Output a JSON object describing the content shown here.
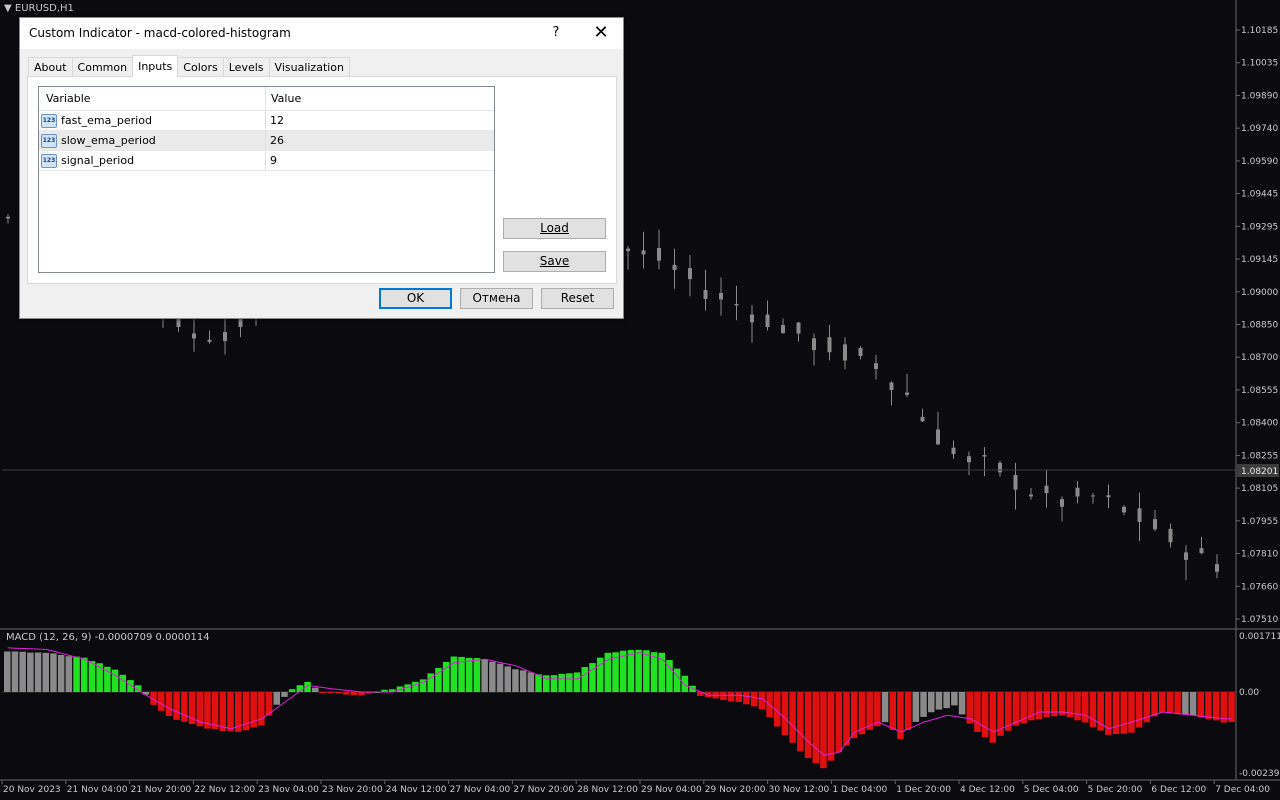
{
  "window": {
    "symbol": "EURUSD,H1",
    "macd_label": "MACD (12, 26, 9)  -0.0000709 0.0000114"
  },
  "dialog": {
    "title": "Custom Indicator - macd-colored-histogram",
    "help_glyph": "?",
    "close_glyph": "✕",
    "tabs": [
      {
        "label": "About"
      },
      {
        "label": "Common"
      },
      {
        "label": "Inputs"
      },
      {
        "label": "Colors"
      },
      {
        "label": "Levels"
      },
      {
        "label": "Visualization"
      }
    ],
    "active_tab": "Inputs",
    "grid": {
      "columns": [
        "Variable",
        "Value"
      ],
      "rows": [
        {
          "icon": "123",
          "variable": "fast_ema_period",
          "value": "12"
        },
        {
          "icon": "123",
          "variable": "slow_ema_period",
          "value": "26"
        },
        {
          "icon": "123",
          "variable": "signal_period",
          "value": "9"
        }
      ]
    },
    "load_label": "Load",
    "save_label": "Save",
    "ok_label": "OK",
    "cancel_label": "Отмена",
    "reset_label": "Reset"
  },
  "colors": {
    "background": "#0b0b0f",
    "candle": "#8a8a8a",
    "histogram_green": "#22e022",
    "histogram_red": "#e01010",
    "histogram_gray": "#8a8a8a",
    "signal_line": "#e020e0",
    "current_price_bg": "#3c3c3c"
  },
  "chart_data": [
    {
      "type": "candlestick",
      "title": "EURUSD,H1",
      "y_ticks": [
        "1.10185",
        "1.10035",
        "1.09890",
        "1.09740",
        "1.09590",
        "1.09445",
        "1.09295",
        "1.09145",
        "1.09000",
        "1.08850",
        "1.08700",
        "1.08555",
        "1.08400",
        "1.08255",
        "1.08105",
        "1.07955",
        "1.07810",
        "1.07660",
        "1.07510"
      ],
      "ylim": [
        1.0751,
        1.1026
      ],
      "current_price": "1.08201",
      "close_path": [
        [
          0,
          1.093
        ],
        [
          5,
          1.0935
        ],
        [
          8,
          1.0905
        ],
        [
          10,
          1.0888
        ],
        [
          12,
          1.0873
        ],
        [
          14,
          1.0876
        ],
        [
          16,
          1.0883
        ],
        [
          18,
          1.0895
        ],
        [
          20,
          1.0925
        ],
        [
          22,
          1.096
        ],
        [
          24,
          1.099
        ],
        [
          26,
          1.1005
        ],
        [
          28,
          1.1
        ],
        [
          30,
          1.0988
        ],
        [
          32,
          1.0975
        ],
        [
          34,
          1.0965
        ],
        [
          36,
          1.0948
        ],
        [
          38,
          1.0925
        ],
        [
          40,
          1.0915
        ],
        [
          42,
          1.091
        ],
        [
          44,
          1.09
        ],
        [
          46,
          1.0892
        ],
        [
          48,
          1.0885
        ],
        [
          50,
          1.0878
        ],
        [
          52,
          1.087
        ],
        [
          54,
          1.0865
        ],
        [
          56,
          1.086
        ],
        [
          58,
          1.0845
        ],
        [
          60,
          1.0825
        ],
        [
          62,
          1.0812
        ],
        [
          64,
          1.0808
        ],
        [
          66,
          1.0798
        ],
        [
          68,
          1.0793
        ],
        [
          70,
          1.0795
        ],
        [
          72,
          1.0789
        ],
        [
          74,
          1.078
        ],
        [
          76,
          1.077
        ],
        [
          78,
          1.0763
        ]
      ]
    },
    {
      "type": "bar",
      "title": "MACD (12, 26, 9)",
      "values_text": [
        "-0.0000709",
        "0.0000114"
      ],
      "y_ticks": [
        "0.0017115",
        "0.00",
        "-0.0023995"
      ],
      "ylim": [
        -0.0023995,
        0.0017115
      ],
      "x_ticks": [
        "20 Nov 2023",
        "21 Nov 04:00",
        "21 Nov 20:00",
        "22 Nov 12:00",
        "23 Nov 04:00",
        "23 Nov 20:00",
        "24 Nov 12:00",
        "27 Nov 04:00",
        "27 Nov 20:00",
        "28 Nov 12:00",
        "29 Nov 04:00",
        "29 Nov 20:00",
        "30 Nov 12:00",
        "1 Dec 04:00",
        "1 Dec 20:00",
        "4 Dec 12:00",
        "5 Dec 04:00",
        "5 Dec 20:00",
        "6 Dec 12:00",
        "7 Dec 04:00"
      ],
      "histogram_path": [
        [
          0,
          0.00125
        ],
        [
          6,
          0.00118
        ],
        [
          10,
          0.00105
        ],
        [
          14,
          0.0007
        ],
        [
          17,
          0.0002
        ],
        [
          19,
          -0.0004
        ],
        [
          22,
          -0.00085
        ],
        [
          26,
          -0.0011
        ],
        [
          30,
          -0.0012
        ],
        [
          33,
          -0.001
        ],
        [
          35,
          -0.0004
        ],
        [
          37,
          0.0001
        ],
        [
          39,
          0.0003
        ],
        [
          41,
          0.0
        ],
        [
          46,
          -0.0001
        ],
        [
          50,
          0.0001
        ],
        [
          54,
          0.0004
        ],
        [
          58,
          0.0011
        ],
        [
          62,
          0.001
        ],
        [
          66,
          0.0007
        ],
        [
          70,
          0.0005
        ],
        [
          74,
          0.0006
        ],
        [
          78,
          0.0012
        ],
        [
          82,
          0.0013
        ],
        [
          85,
          0.0012
        ],
        [
          88,
          0.0005
        ],
        [
          90,
          -0.0001
        ],
        [
          92,
          -0.0002
        ],
        [
          95,
          -0.0003
        ],
        [
          98,
          -0.0005
        ],
        [
          101,
          -0.0013
        ],
        [
          104,
          -0.002
        ],
        [
          106,
          -0.0023
        ],
        [
          108,
          -0.0018
        ],
        [
          110,
          -0.0014
        ],
        [
          114,
          -0.0009
        ],
        [
          116,
          -0.0014
        ],
        [
          118,
          -0.0009
        ],
        [
          120,
          -0.0006
        ],
        [
          123,
          -0.0004
        ],
        [
          126,
          -0.0012
        ],
        [
          128,
          -0.0015
        ],
        [
          131,
          -0.001
        ],
        [
          134,
          -0.0008
        ],
        [
          137,
          -0.0007
        ],
        [
          140,
          -0.0009
        ],
        [
          143,
          -0.0013
        ],
        [
          146,
          -0.0012
        ],
        [
          150,
          -0.0006
        ],
        [
          154,
          -0.0007
        ],
        [
          158,
          -0.0009
        ]
      ],
      "signal_path": [
        [
          0,
          0.00135
        ],
        [
          5,
          0.0013
        ],
        [
          10,
          0.001
        ],
        [
          14,
          0.0005
        ],
        [
          18,
          -0.0001
        ],
        [
          21,
          -0.0005
        ],
        [
          25,
          -0.0009
        ],
        [
          29,
          -0.0011
        ],
        [
          33,
          -0.0008
        ],
        [
          36,
          -0.0003
        ],
        [
          39,
          0.0002
        ],
        [
          42,
          0.0001
        ],
        [
          46,
          0.0
        ],
        [
          50,
          0.0
        ],
        [
          54,
          0.0003
        ],
        [
          58,
          0.0009
        ],
        [
          62,
          0.001
        ],
        [
          66,
          0.0008
        ],
        [
          70,
          0.0004
        ],
        [
          74,
          0.0004
        ],
        [
          78,
          0.001
        ],
        [
          82,
          0.0012
        ],
        [
          85,
          0.001
        ],
        [
          88,
          0.0002
        ],
        [
          91,
          -0.0001
        ],
        [
          95,
          -0.0001
        ],
        [
          98,
          -0.0002
        ],
        [
          101,
          -0.0008
        ],
        [
          104,
          -0.0015
        ],
        [
          106,
          -0.0019
        ],
        [
          108,
          -0.0018
        ],
        [
          110,
          -0.0012
        ],
        [
          113,
          -0.0009
        ],
        [
          116,
          -0.0012
        ],
        [
          119,
          -0.0009
        ],
        [
          122,
          -0.0007
        ],
        [
          125,
          -0.0008
        ],
        [
          128,
          -0.0012
        ],
        [
          131,
          -0.0009
        ],
        [
          134,
          -0.0006
        ],
        [
          137,
          -0.0006
        ],
        [
          140,
          -0.0007
        ],
        [
          143,
          -0.0011
        ],
        [
          146,
          -0.0009
        ],
        [
          150,
          -0.0006
        ],
        [
          154,
          -0.0007
        ],
        [
          158,
          -0.0008
        ]
      ]
    }
  ]
}
